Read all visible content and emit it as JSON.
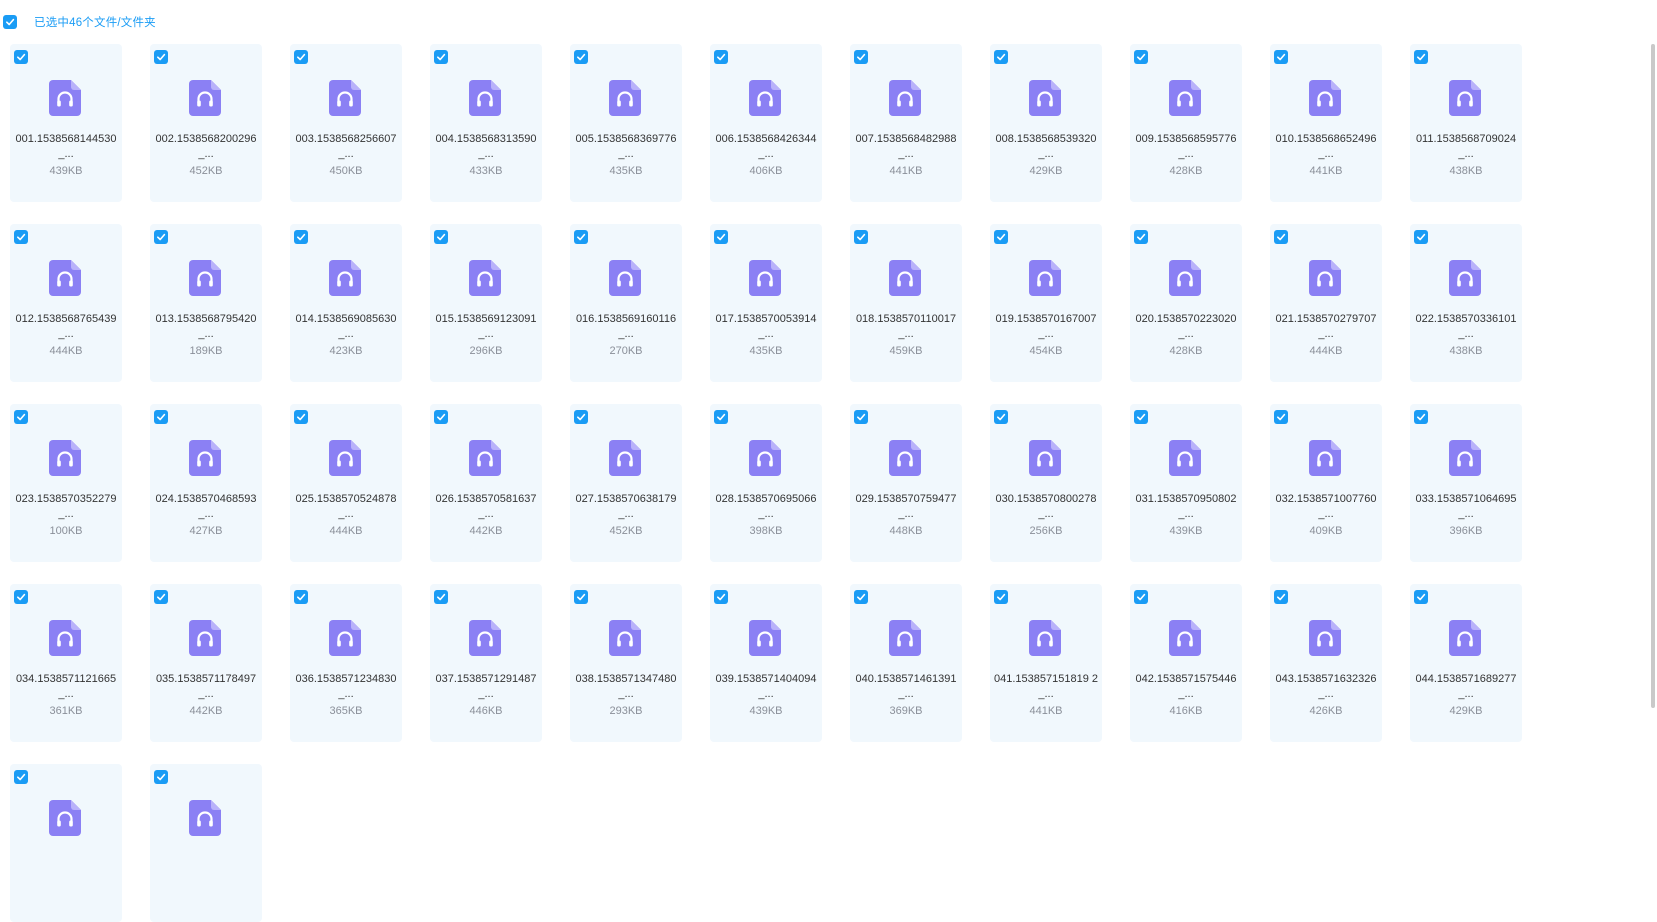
{
  "selection": {
    "label": "已选中46个文件/文件夹",
    "checked": true
  },
  "accent_color": "#1a9cf5",
  "file_icon": "audio-file-headphones-icon",
  "files": [
    {
      "name": "001.1538568144530_...",
      "size": "439KB"
    },
    {
      "name": "002.1538568200296_...",
      "size": "452KB"
    },
    {
      "name": "003.1538568256607_...",
      "size": "450KB"
    },
    {
      "name": "004.1538568313590_...",
      "size": "433KB"
    },
    {
      "name": "005.1538568369776_...",
      "size": "435KB"
    },
    {
      "name": "006.1538568426344_...",
      "size": "406KB"
    },
    {
      "name": "007.1538568482988_...",
      "size": "441KB"
    },
    {
      "name": "008.1538568539320_...",
      "size": "429KB"
    },
    {
      "name": "009.1538568595776_...",
      "size": "428KB"
    },
    {
      "name": "010.1538568652496_...",
      "size": "441KB"
    },
    {
      "name": "011.1538568709024_...",
      "size": "438KB"
    },
    {
      "name": "012.1538568765439_...",
      "size": "444KB"
    },
    {
      "name": "013.1538568795420_...",
      "size": "189KB"
    },
    {
      "name": "014.1538569085630_...",
      "size": "423KB"
    },
    {
      "name": "015.1538569123091_...",
      "size": "296KB"
    },
    {
      "name": "016.1538569160116_...",
      "size": "270KB"
    },
    {
      "name": "017.1538570053914_...",
      "size": "435KB"
    },
    {
      "name": "018.1538570110017_...",
      "size": "459KB"
    },
    {
      "name": "019.1538570167007_...",
      "size": "454KB"
    },
    {
      "name": "020.1538570223020_...",
      "size": "428KB"
    },
    {
      "name": "021.1538570279707_...",
      "size": "444KB"
    },
    {
      "name": "022.1538570336101_...",
      "size": "438KB"
    },
    {
      "name": "023.1538570352279_...",
      "size": "100KB"
    },
    {
      "name": "024.1538570468593_...",
      "size": "427KB"
    },
    {
      "name": "025.1538570524878_...",
      "size": "444KB"
    },
    {
      "name": "026.1538570581637_...",
      "size": "442KB"
    },
    {
      "name": "027.1538570638179_...",
      "size": "452KB"
    },
    {
      "name": "028.1538570695066_...",
      "size": "398KB"
    },
    {
      "name": "029.1538570759477_...",
      "size": "448KB"
    },
    {
      "name": "030.1538570800278_...",
      "size": "256KB"
    },
    {
      "name": "031.1538570950802_...",
      "size": "439KB"
    },
    {
      "name": "032.1538571007760_...",
      "size": "409KB"
    },
    {
      "name": "033.1538571064695_...",
      "size": "396KB"
    },
    {
      "name": "034.1538571121665_...",
      "size": "361KB"
    },
    {
      "name": "035.1538571178497_...",
      "size": "442KB"
    },
    {
      "name": "036.1538571234830_...",
      "size": "365KB"
    },
    {
      "name": "037.1538571291487_...",
      "size": "446KB"
    },
    {
      "name": "038.1538571347480_...",
      "size": "293KB"
    },
    {
      "name": "039.1538571404094_...",
      "size": "439KB"
    },
    {
      "name": "040.1538571461391_...",
      "size": "369KB"
    },
    {
      "name": "041.153857151819 2_...",
      "size": "441KB"
    },
    {
      "name": "042.1538571575446_...",
      "size": "416KB"
    },
    {
      "name": "043.1538571632326_...",
      "size": "426KB"
    },
    {
      "name": "044.1538571689277_...",
      "size": "429KB"
    },
    {
      "name": "",
      "size": ""
    },
    {
      "name": "",
      "size": ""
    }
  ]
}
